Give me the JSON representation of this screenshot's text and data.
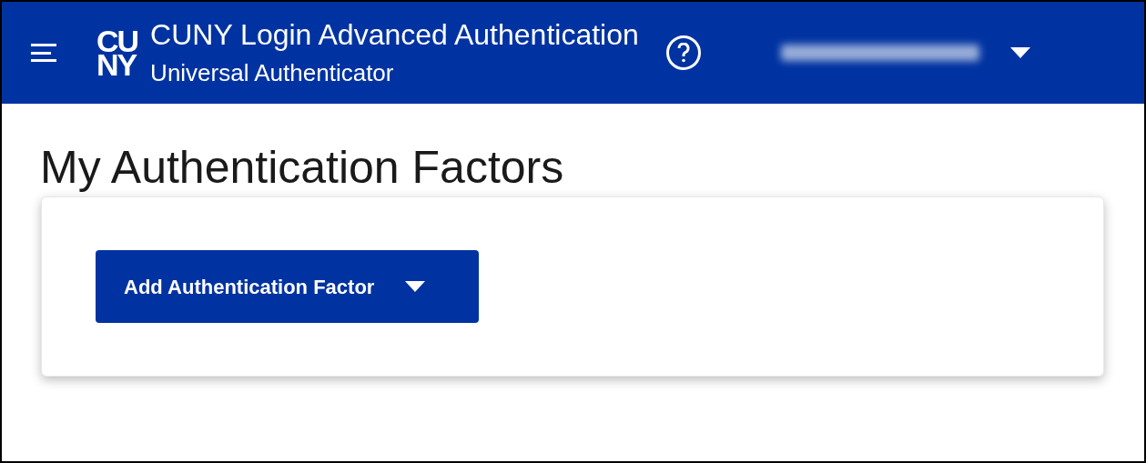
{
  "header": {
    "logo_lines": [
      "CU",
      "NY"
    ],
    "title": "CUNY Login Advanced Authentication",
    "subtitle": "Universal Authenticator"
  },
  "page_title": "My Authentication Factors",
  "add_button": {
    "label": "Add Authentication Factor"
  }
}
